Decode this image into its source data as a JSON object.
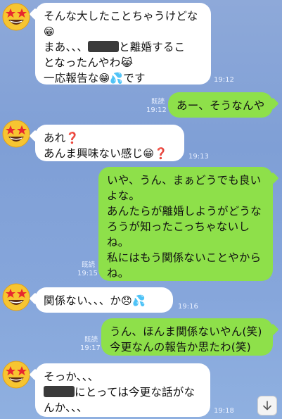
{
  "messages": [
    {
      "side": "left",
      "lines": [
        "そんな大したことちゃうけどな😁",
        "まあ、、、[redacted]と離婚するこ",
        "となったんやわ😹",
        "一応報告な😁💦です"
      ],
      "time": "19:12"
    },
    {
      "side": "right",
      "lines": [
        "あー、そうなんや"
      ],
      "read": "既読",
      "time": "19:12"
    },
    {
      "side": "left",
      "lines": [
        "あれ❓",
        "あんま興味ない感じ😁❓"
      ],
      "time": "19:13"
    },
    {
      "side": "right",
      "lines": [
        "いや、うん、まぁどうでも良い",
        "よな。",
        "あんたらが離婚しようがどうな",
        "ろうが知ったこっちゃないし",
        "ね。",
        "私にはもう関係ないことやから",
        "ね。"
      ],
      "read": "既読",
      "time": "19:15"
    },
    {
      "side": "left",
      "lines": [
        "関係ない、、、か😞💦"
      ],
      "time": "19:16"
    },
    {
      "side": "right",
      "lines": [
        "うん、ほんま関係ないやん(笑)",
        "今更なんの報告か思たわ(笑)"
      ],
      "read": "既読",
      "time": "19:17"
    },
    {
      "side": "left",
      "lines": [
        "そっか、、、",
        "[redacted]にとっては今更な話がな",
        "んか、、、"
      ],
      "time": "19:18"
    }
  ],
  "icons": {
    "avatar": "star-struck-emoji-icon",
    "scroll": "arrow-down-icon"
  },
  "colors": {
    "incoming_bubble": "#ffffff",
    "outgoing_bubble": "#8ee04a",
    "background": "#8ea9d9"
  }
}
